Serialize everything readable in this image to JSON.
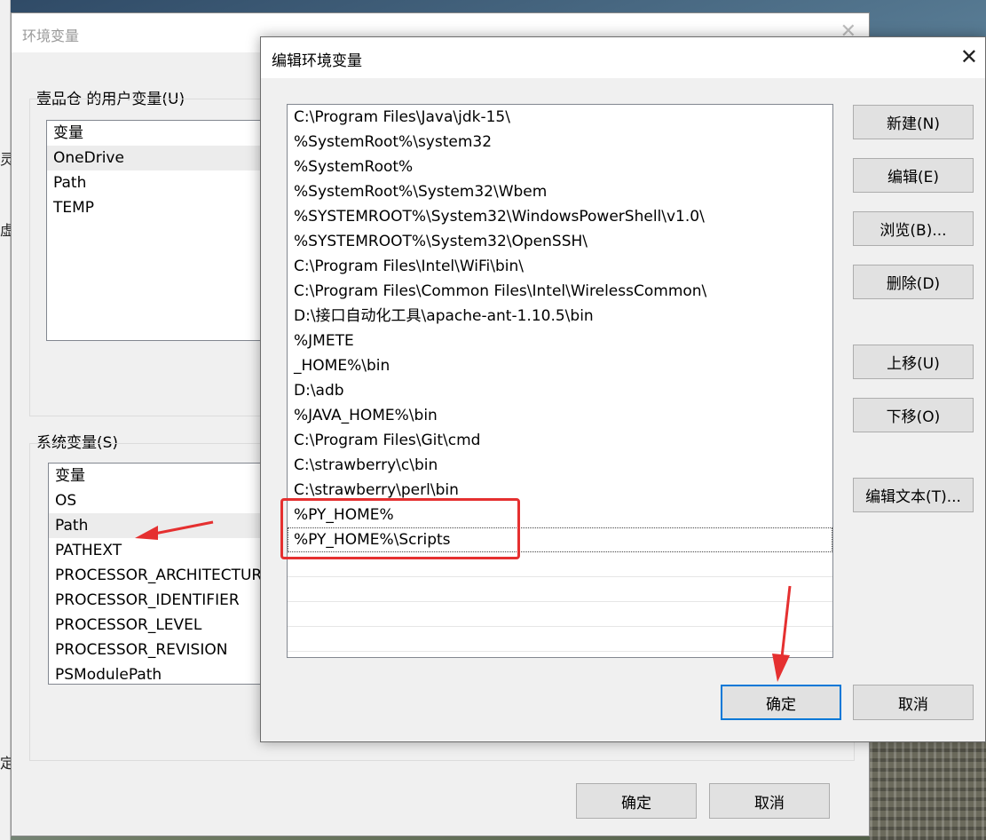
{
  "env_window": {
    "title": "环境变量",
    "user_vars_label": "壹品仓 的用户变量(U)",
    "user_vars": {
      "header": "变量",
      "rows": [
        "OneDrive",
        "Path",
        "TEMP"
      ],
      "selected_index": 0
    },
    "system_vars_label": "系统变量(S)",
    "system_vars": {
      "header": "变量",
      "rows": [
        "OS",
        "Path",
        "PATHEXT",
        "PROCESSOR_ARCHITECTUR",
        "PROCESSOR_IDENTIFIER",
        "PROCESSOR_LEVEL",
        "PROCESSOR_REVISION",
        "PSModulePath"
      ],
      "selected_index": 1
    },
    "ok_label": "确定",
    "cancel_label": "取消",
    "left_strip_chars": [
      "灵",
      "虚",
      "定"
    ]
  },
  "edit_dialog": {
    "title": "编辑环境变量",
    "paths": [
      "C:\\Program Files\\Java\\jdk-15\\",
      "%SystemRoot%\\system32",
      "%SystemRoot%",
      "%SystemRoot%\\System32\\Wbem",
      "%SYSTEMROOT%\\System32\\WindowsPowerShell\\v1.0\\",
      "%SYSTEMROOT%\\System32\\OpenSSH\\",
      "C:\\Program Files\\Intel\\WiFi\\bin\\",
      "C:\\Program Files\\Common Files\\Intel\\WirelessCommon\\",
      "D:\\接口自动化工具\\apache-ant-1.10.5\\bin",
      "%JMETE",
      "_HOME%\\bin",
      "D:\\adb",
      "%JAVA_HOME%\\bin",
      "C:\\Program Files\\Git\\cmd",
      "C:\\strawberry\\c\\bin",
      "C:\\strawberry\\perl\\bin",
      "%PY_HOME%",
      "%PY_HOME%\\Scripts"
    ],
    "focused_index": 17,
    "buttons": {
      "new": "新建(N)",
      "edit": "编辑(E)",
      "browse": "浏览(B)...",
      "delete": "删除(D)",
      "move_up": "上移(U)",
      "move_down": "下移(O)",
      "edit_text": "编辑文本(T)...",
      "ok": "确定",
      "cancel": "取消"
    }
  },
  "annotations": {
    "highlight_color": "#e53030"
  }
}
